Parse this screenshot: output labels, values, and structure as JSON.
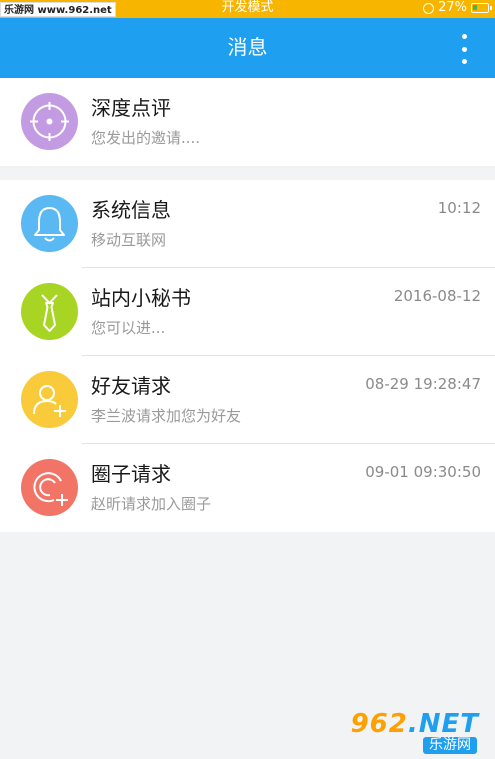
{
  "status_bar": {
    "watermark": "乐游网 www.962.net",
    "mode": "开发模式",
    "battery": "27%"
  },
  "header": {
    "title": "消息"
  },
  "pinned": [
    {
      "name": "深度点评",
      "subtitle": "您发出的邀请....",
      "time": "",
      "icon": "target-icon",
      "color": "#c39be3"
    }
  ],
  "messages": [
    {
      "name": "系统信息",
      "subtitle": "移动互联网",
      "time": "10:12",
      "icon": "bell-icon",
      "color": "#5ab8f2"
    },
    {
      "name": "站内小秘书",
      "subtitle": "您可以进...",
      "time": "2016-08-12",
      "icon": "tie-icon",
      "color": "#a8d423"
    },
    {
      "name": "好友请求",
      "subtitle": "李兰波请求加您为好友",
      "time": "08-29 19:28:47",
      "icon": "add-friend-icon",
      "color": "#f9cb3a"
    },
    {
      "name": "圈子请求",
      "subtitle": "赵昕请求加入圈子",
      "time": "09-01 09:30:50",
      "icon": "add-circle-icon",
      "color": "#f27467"
    }
  ],
  "watermark_bottom": {
    "number_a": "962",
    "number_b": ".NET",
    "site": "乐游网"
  }
}
